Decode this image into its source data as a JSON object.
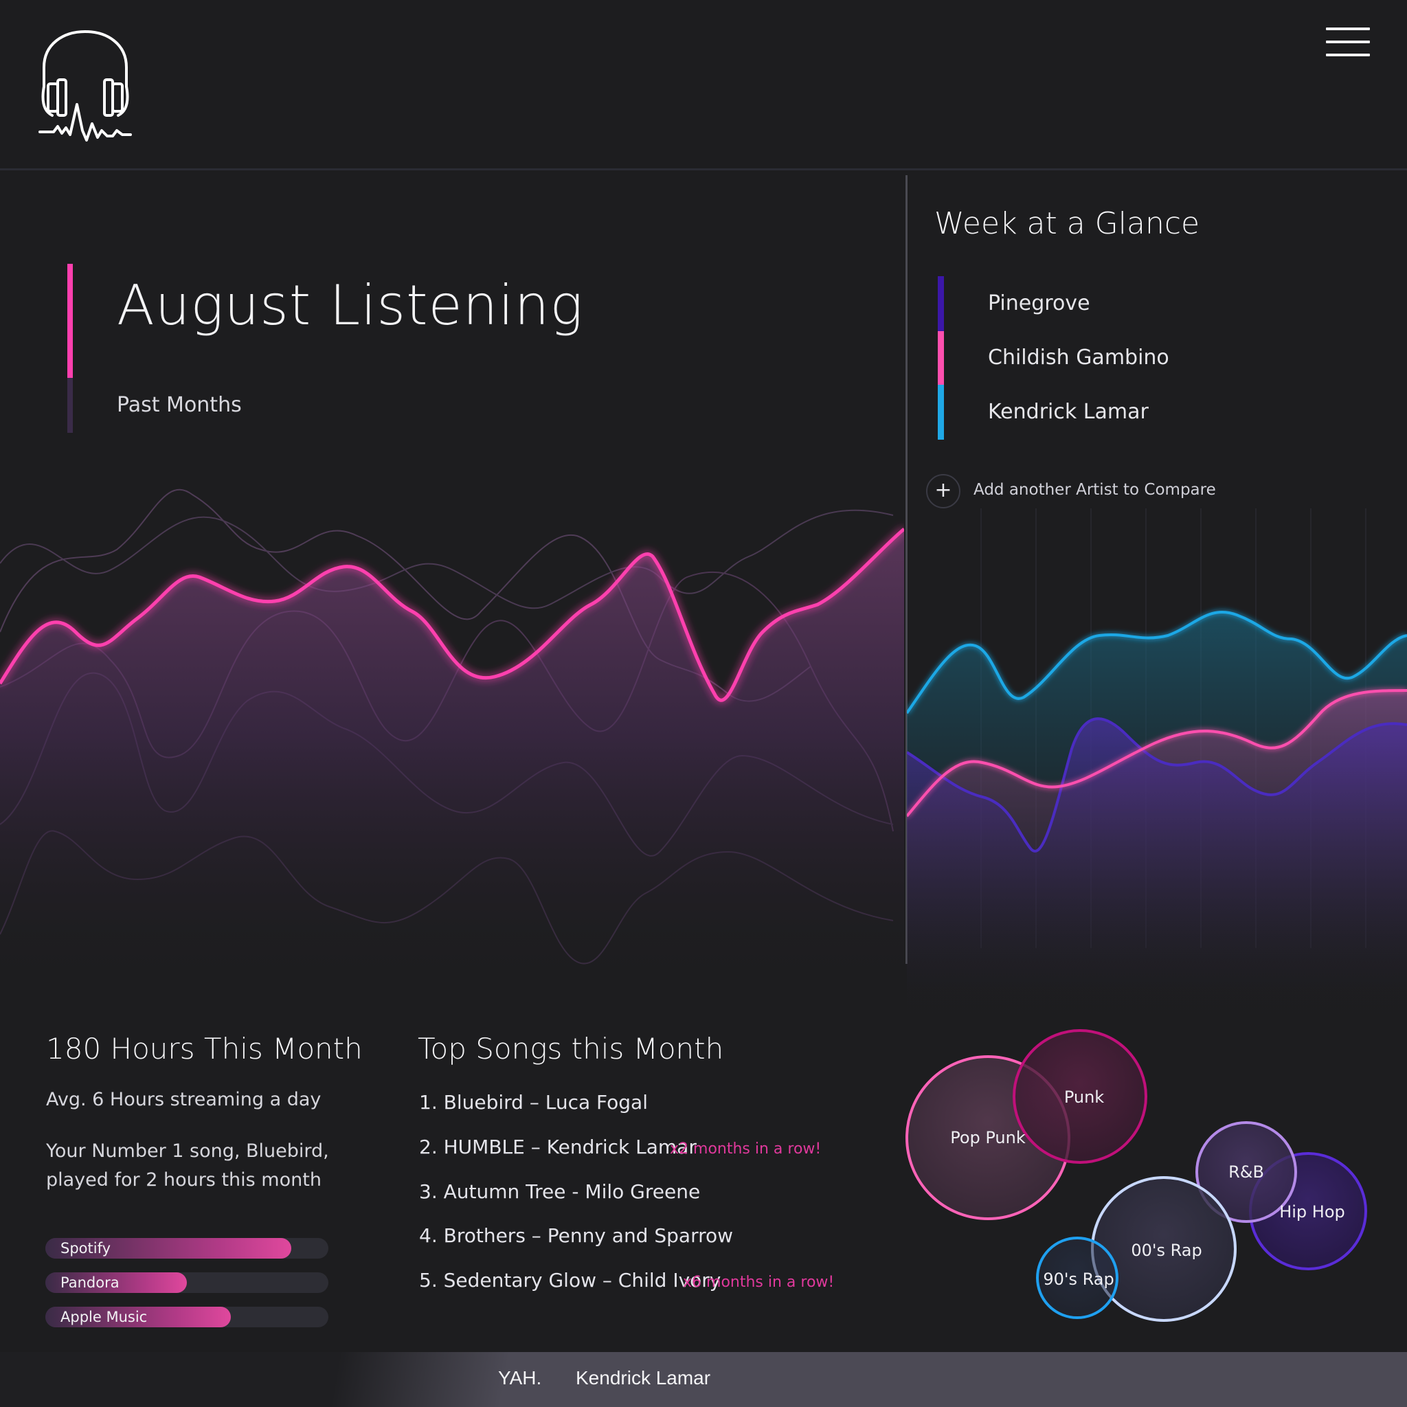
{
  "header": {
    "logo_icon": "headphones-heartbeat-icon",
    "menu_icon": "hamburger-menu-icon"
  },
  "main": {
    "title": "August Listening",
    "subtitle": "Past Months"
  },
  "week": {
    "title": "Week at a Glance",
    "artists": [
      {
        "name": "Pinegrove",
        "color": "#3b17a8"
      },
      {
        "name": "Childish Gambino",
        "color": "#ff4fae"
      },
      {
        "name": "Kendrick Lamar",
        "color": "#1fa8e6"
      }
    ],
    "add_icon": "plus-icon",
    "add_label": "Add another Artist to Compare"
  },
  "stats": {
    "title": "180 Hours This Month",
    "avg": "Avg. 6 Hours streaming a day",
    "note_line1": "Your Number 1 song, Bluebird,",
    "note_line2": "played for 2 hours this month",
    "services": [
      {
        "name": "Spotify",
        "share": 0.87
      },
      {
        "name": "Pandora",
        "share": 0.5
      },
      {
        "name": "Apple Music",
        "share": 0.66
      }
    ]
  },
  "top_songs": {
    "title": "Top Songs this Month",
    "items": [
      {
        "text": "1. Bluebird – Luca Fogal",
        "streak": ""
      },
      {
        "text": "2. HUMBLE – Kendrick Lamar",
        "streak": "x2 months in a row!"
      },
      {
        "text": "3. Autumn Tree - Milo Greene",
        "streak": ""
      },
      {
        "text": "4. Brothers – Penny and Sparrow",
        "streak": ""
      },
      {
        "text": "5. Sedentary Glow – Child Ivory",
        "streak": "x6 months in a row!"
      }
    ]
  },
  "genres": [
    "Pop Punk",
    "Punk",
    "R&B",
    "Hip Hop",
    "00's Rap",
    "90's Rap"
  ],
  "now_playing": {
    "song": "YAH.",
    "artist": "Kendrick Lamar"
  },
  "colors": {
    "accent_pink": "#ff3fae",
    "accent_blue": "#1fa8e6",
    "accent_purple": "#3b17a8",
    "background": "#1d1d1f"
  }
}
